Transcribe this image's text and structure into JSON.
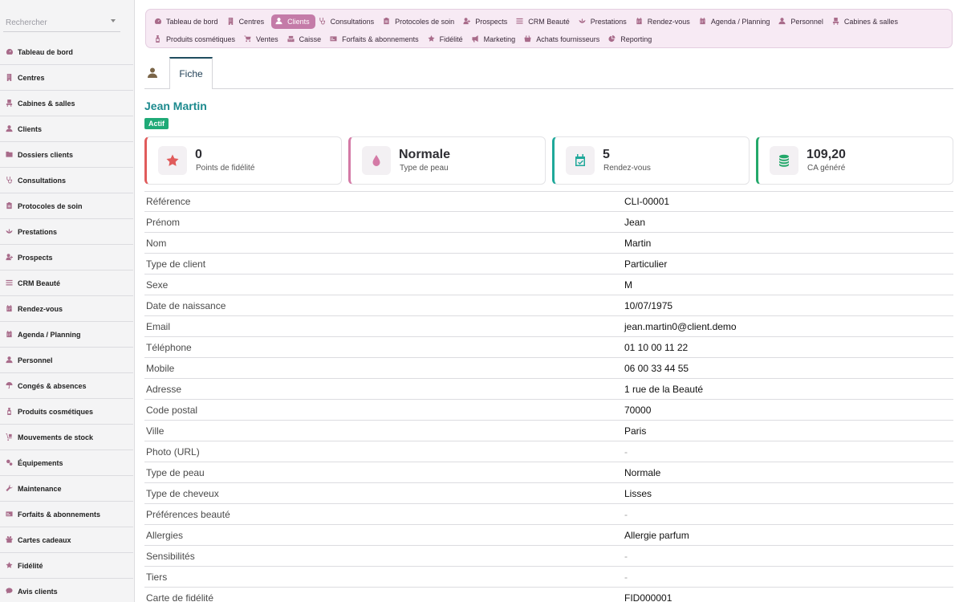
{
  "sidebar": {
    "search_placeholder": "Rechercher",
    "items": [
      {
        "label": "Tableau de bord",
        "icon": "gauge-icon"
      },
      {
        "label": "Centres",
        "icon": "building-icon"
      },
      {
        "label": "Cabines & salles",
        "icon": "chair-icon"
      },
      {
        "label": "Clients",
        "icon": "user-icon"
      },
      {
        "label": "Dossiers clients",
        "icon": "folder-icon"
      },
      {
        "label": "Consultations",
        "icon": "stethoscope-icon"
      },
      {
        "label": "Protocoles de soin",
        "icon": "clipboard-icon"
      },
      {
        "label": "Prestations",
        "icon": "spa-icon"
      },
      {
        "label": "Prospects",
        "icon": "user-plus-icon"
      },
      {
        "label": "CRM Beauté",
        "icon": "list-icon"
      },
      {
        "label": "Rendez-vous",
        "icon": "calendar-icon"
      },
      {
        "label": "Agenda / Planning",
        "icon": "calendar-icon"
      },
      {
        "label": "Personnel",
        "icon": "user-icon"
      },
      {
        "label": "Congés & absences",
        "icon": "umbrella-icon"
      },
      {
        "label": "Produits cosmétiques",
        "icon": "bottle-icon"
      },
      {
        "label": "Mouvements de stock",
        "icon": "dolly-icon"
      },
      {
        "label": "Équipements",
        "icon": "cogs-icon"
      },
      {
        "label": "Maintenance",
        "icon": "wrench-icon"
      },
      {
        "label": "Forfaits & abonnements",
        "icon": "card-icon"
      },
      {
        "label": "Cartes cadeaux",
        "icon": "gift-icon"
      },
      {
        "label": "Fidélité",
        "icon": "star-icon"
      },
      {
        "label": "Avis clients",
        "icon": "comment-icon"
      }
    ]
  },
  "topnav": {
    "row1": [
      {
        "label": "Tableau de bord",
        "icon": "gauge-icon",
        "active": false
      },
      {
        "label": "Centres",
        "icon": "building-icon",
        "active": false
      },
      {
        "label": "Clients",
        "icon": "user-icon",
        "active": true
      },
      {
        "label": "Consultations",
        "icon": "stethoscope-icon",
        "active": false
      },
      {
        "label": "Protocoles de soin",
        "icon": "clipboard-icon",
        "active": false
      },
      {
        "label": "Prospects",
        "icon": "user-plus-icon",
        "active": false
      },
      {
        "label": "CRM Beauté",
        "icon": "list-icon",
        "active": false
      },
      {
        "label": "Prestations",
        "icon": "spa-icon",
        "active": false
      },
      {
        "label": "Rendez-vous",
        "icon": "calendar-icon",
        "active": false
      },
      {
        "label": "Agenda / Planning",
        "icon": "calendar-icon",
        "active": false
      },
      {
        "label": "Personnel",
        "icon": "user-icon",
        "active": false
      },
      {
        "label": "Cabines & salles",
        "icon": "chair-icon",
        "active": false
      }
    ],
    "row2": [
      {
        "label": "Produits cosmétiques",
        "icon": "bottle-icon",
        "active": false
      },
      {
        "label": "Ventes",
        "icon": "cart-icon",
        "active": false
      },
      {
        "label": "Caisse",
        "icon": "cash-register-icon",
        "active": false
      },
      {
        "label": "Forfaits & abonnements",
        "icon": "card-icon",
        "active": false
      },
      {
        "label": "Fidélité",
        "icon": "star-icon",
        "active": false
      },
      {
        "label": "Marketing",
        "icon": "megaphone-icon",
        "active": false
      },
      {
        "label": "Achats fournisseurs",
        "icon": "basket-icon",
        "active": false
      },
      {
        "label": "Reporting",
        "icon": "pie-chart-icon",
        "active": false
      }
    ]
  },
  "tabs": {
    "fiche_label": "Fiche"
  },
  "client": {
    "name": "Jean Martin",
    "status": "Actif"
  },
  "stats": [
    {
      "value": "0",
      "label": "Points de fidélité",
      "icon": "star-icon",
      "accent": "#e05b5b"
    },
    {
      "value": "Normale",
      "label": "Type de peau",
      "icon": "droplet-icon",
      "accent": "#d47aa6"
    },
    {
      "value": "5",
      "label": "Rendez-vous",
      "icon": "calendar-check-icon",
      "accent": "#1fa89a"
    },
    {
      "value": "109,20",
      "label": "CA généré",
      "icon": "coins-icon",
      "accent": "#23a86a"
    }
  ],
  "details": [
    {
      "key": "Référence",
      "value": "CLI-00001"
    },
    {
      "key": "Prénom",
      "value": "Jean"
    },
    {
      "key": "Nom",
      "value": "Martin"
    },
    {
      "key": "Type de client",
      "value": "Particulier"
    },
    {
      "key": "Sexe",
      "value": "M"
    },
    {
      "key": "Date de naissance",
      "value": "10/07/1975"
    },
    {
      "key": "Email",
      "value": "jean.martin0@client.demo"
    },
    {
      "key": "Téléphone",
      "value": "01 10 00 11 22"
    },
    {
      "key": "Mobile",
      "value": "06 00 33 44 55"
    },
    {
      "key": "Adresse",
      "value": "1 rue de la Beauté"
    },
    {
      "key": "Code postal",
      "value": "70000"
    },
    {
      "key": "Ville",
      "value": "Paris"
    },
    {
      "key": "Photo (URL)",
      "value": "-"
    },
    {
      "key": "Type de peau",
      "value": "Normale"
    },
    {
      "key": "Type de cheveux",
      "value": "Lisses"
    },
    {
      "key": "Préférences beauté",
      "value": "-"
    },
    {
      "key": "Allergies",
      "value": "Allergie parfum"
    },
    {
      "key": "Sensibilités",
      "value": "-"
    },
    {
      "key": "Tiers",
      "value": "-"
    },
    {
      "key": "Carte de fidélité",
      "value": "FID000001"
    }
  ]
}
